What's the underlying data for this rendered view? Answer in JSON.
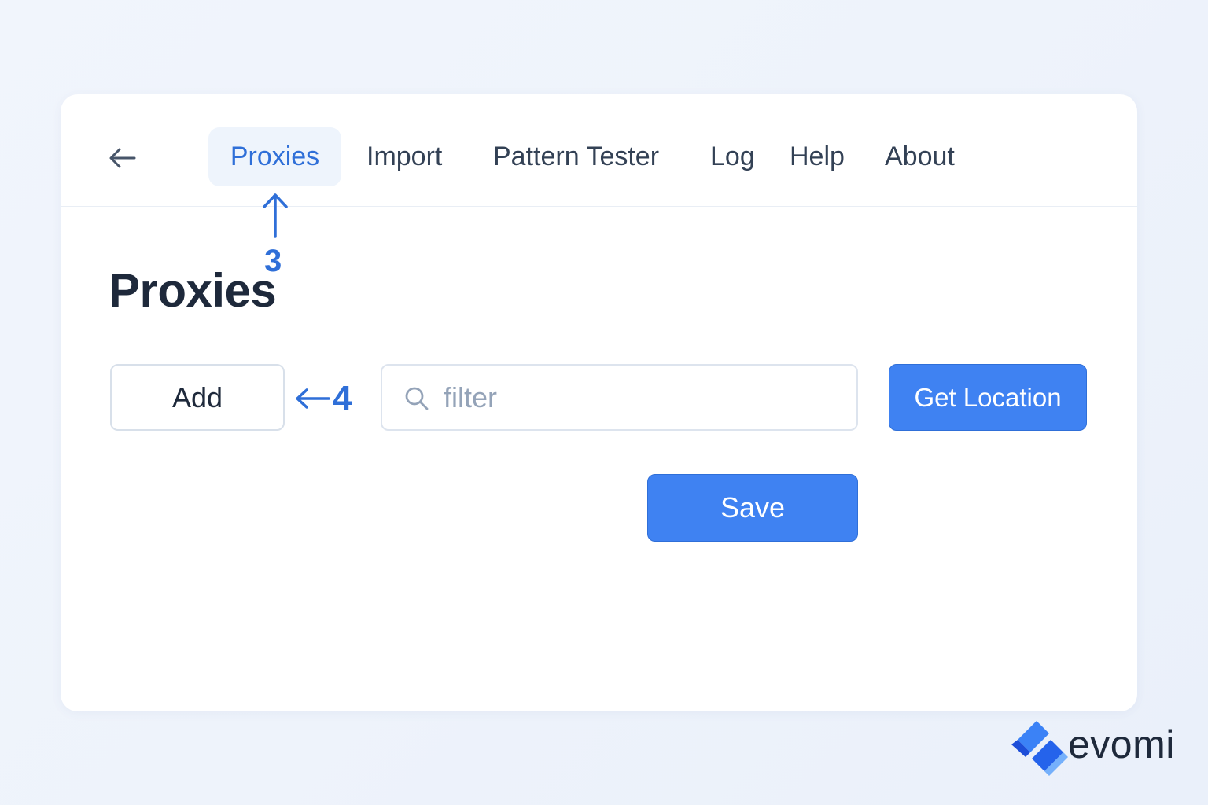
{
  "nav": {
    "back_icon": "arrow-left-icon",
    "tabs": [
      {
        "label": "Proxies",
        "active": true
      },
      {
        "label": "Import",
        "active": false
      },
      {
        "label": "Pattern Tester",
        "active": false
      },
      {
        "label": "Log",
        "active": false
      },
      {
        "label": "Help",
        "active": false
      },
      {
        "label": "About",
        "active": false
      }
    ]
  },
  "annotations": {
    "step_3": "3",
    "step_4": "4"
  },
  "main": {
    "title": "Proxies",
    "add_label": "Add",
    "filter": {
      "placeholder": "filter",
      "value": "",
      "icon": "search-icon"
    },
    "get_location_label": "Get Location",
    "save_label": "Save"
  },
  "brand": {
    "name": "evomi",
    "logo_icon": "evomi-logo-icon"
  },
  "colors": {
    "accent": "#3f82f2",
    "accent_text": "#2f6fd8",
    "active_tab_bg": "#eef4fc",
    "text": "#1e293b",
    "muted": "#94a3b8",
    "background": "#eef3fb"
  }
}
